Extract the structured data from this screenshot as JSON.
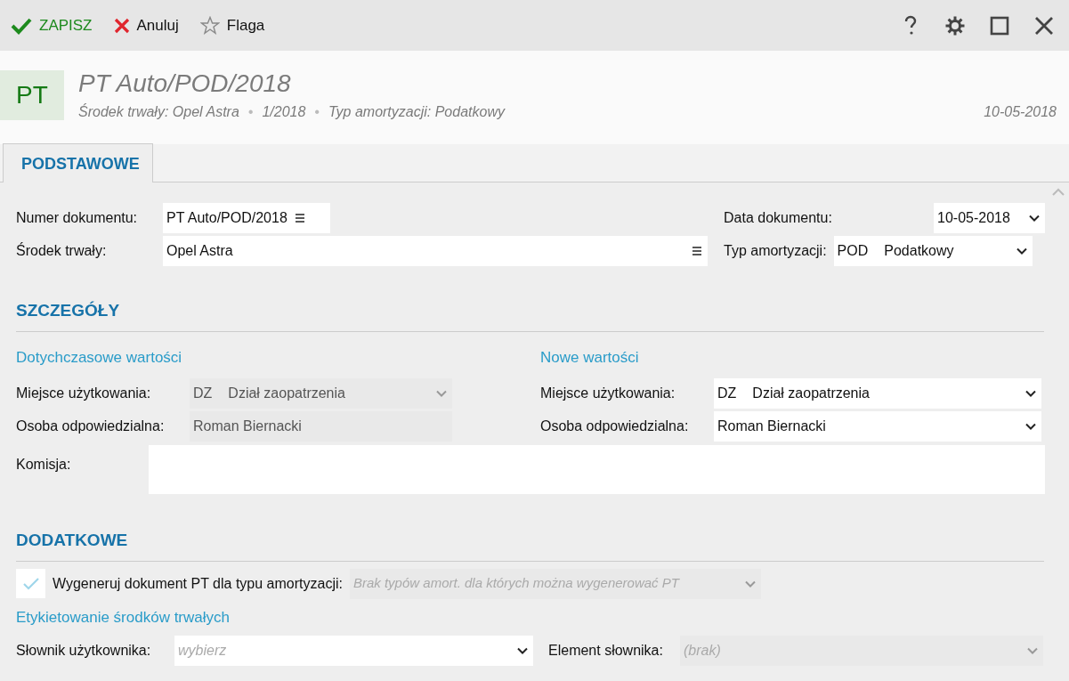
{
  "toolbar": {
    "actions": [
      {
        "kind": "save",
        "label": "ZAPISZ"
      },
      {
        "kind": "cancel",
        "label": "Anuluj"
      },
      {
        "kind": "flag",
        "label": "Flaga"
      }
    ]
  },
  "header": {
    "badge": "PT",
    "title": "PT Auto/POD/2018",
    "meta": [
      "Środek trwały: Opel Astra",
      "1/2018",
      "Typ amortyzacji: Podatkowy"
    ],
    "separator": "•",
    "date": "10-05-2018"
  },
  "tabs": [
    {
      "label": "PODSTAWOWE",
      "selected": true
    }
  ],
  "basic": {
    "left": [
      {
        "label": "Numer dokumentu:",
        "kind": "list",
        "value": "PT Auto/POD/2018",
        "disabled": false
      },
      {
        "label": "Środek trwały:",
        "kind": "list",
        "value": "Opel Astra",
        "disabled": false
      }
    ],
    "right": [
      {
        "label": "Data dokumentu:",
        "kind": "select",
        "value": "10-05-2018",
        "disabled": false
      },
      {
        "label": "Typ amortyzacji:",
        "kind": "select",
        "code": "POD",
        "value": "Podatkowy",
        "disabled": false
      }
    ]
  },
  "details": {
    "title": "SZCZEGÓŁY",
    "columns": [
      {
        "title": "Dotychczasowe wartości",
        "fields": [
          {
            "label": "Miejsce użytkowania:",
            "kind": "select",
            "code": "DZ",
            "value": "Dział zaopatrzenia",
            "disabled": true
          },
          {
            "label": "Osoba odpowiedzialna:",
            "kind": "text",
            "value": "Roman Biernacki",
            "disabled": true
          }
        ]
      },
      {
        "title": "Nowe wartości",
        "fields": [
          {
            "label": "Miejsce użytkowania:",
            "kind": "select",
            "code": "DZ",
            "value": "Dział zaopatrzenia",
            "disabled": false
          },
          {
            "label": "Osoba odpowiedzialna:",
            "kind": "select",
            "value": "Roman Biernacki",
            "disabled": false
          }
        ]
      }
    ],
    "commission": {
      "label": "Komisja:"
    }
  },
  "extra": {
    "title": "DODATKOWE",
    "generate": {
      "checked": true,
      "label": "Wygeneruj dokument PT dla typu amortyzacji:",
      "select": {
        "placeholder": "Brak typów amort. dla których można wygenerować PT",
        "disabled": true
      }
    },
    "subtitle": "Etykietowanie środków trwałych",
    "fields": [
      {
        "label": "Słownik użytkownika:",
        "kind": "select",
        "placeholder": "wybierz",
        "disabled": false
      },
      {
        "label": "Element słownika:",
        "kind": "select",
        "placeholder": "(brak)",
        "disabled": true
      }
    ]
  }
}
